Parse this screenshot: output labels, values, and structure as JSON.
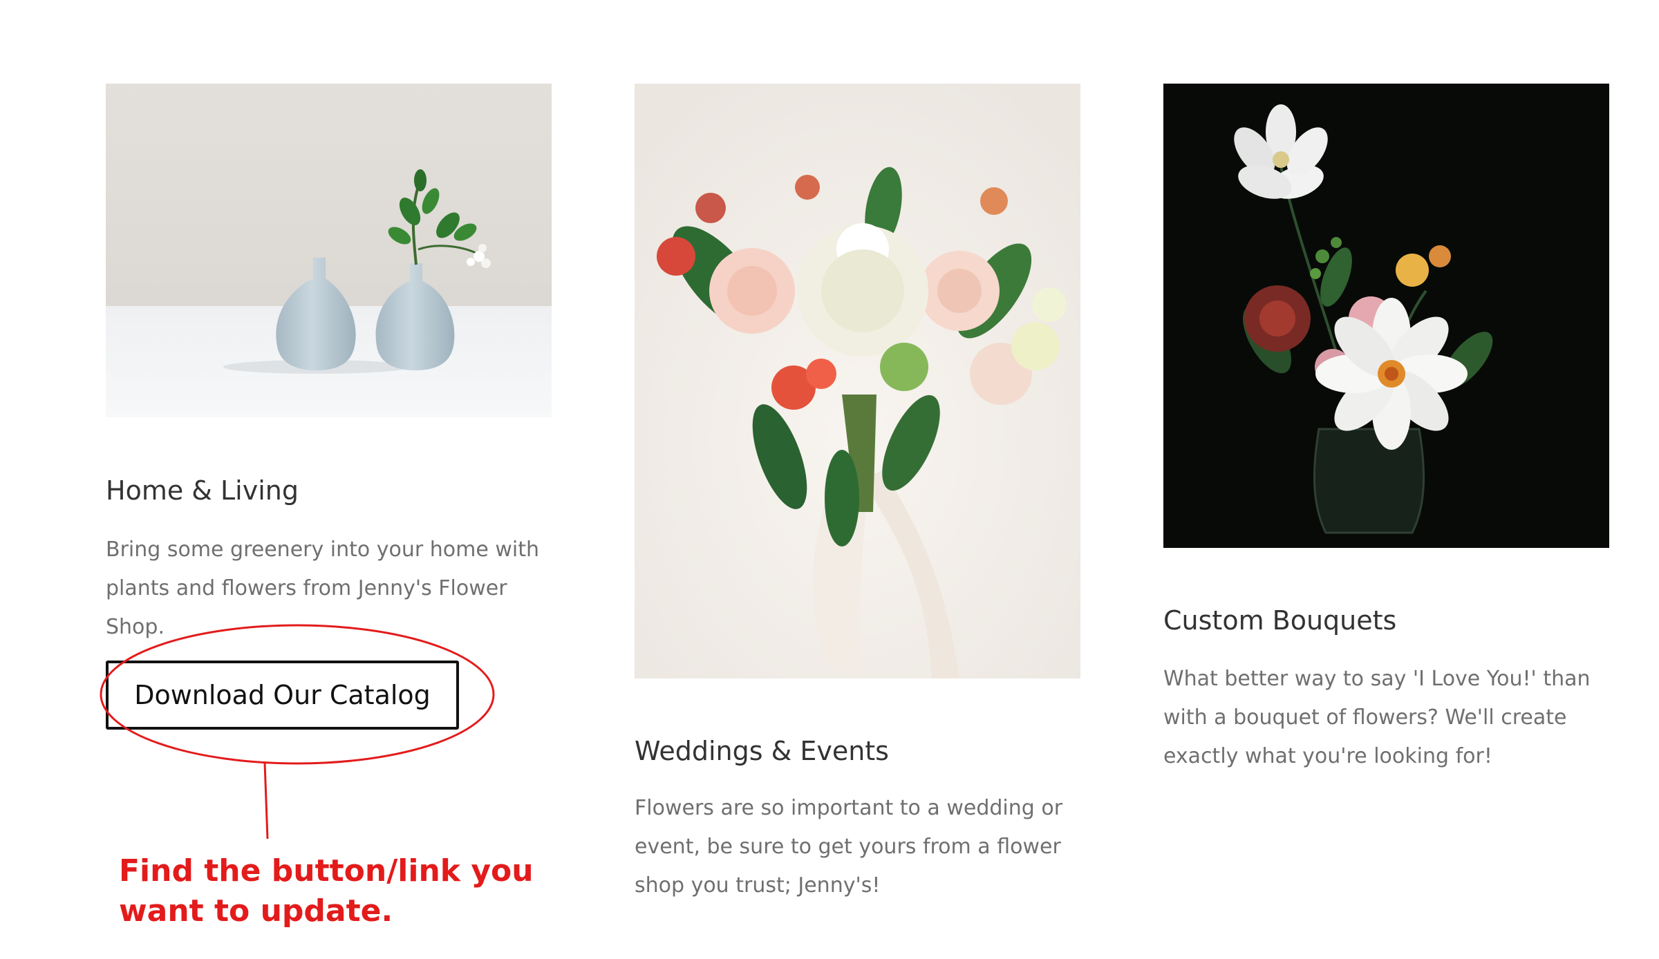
{
  "cards": [
    {
      "title": "Home & Living",
      "description": "Bring some greenery into your home with plants and flowers from Jenny's Flower Shop.",
      "button_label": "Download Our Catalog",
      "image": "two-vases-with-greenery-photo"
    },
    {
      "title": "Weddings & Events",
      "description": "Flowers are so important to a wedding or event, be sure to get yours from a flower shop you trust; Jenny's!",
      "image": "wedding-bouquet-photo"
    },
    {
      "title": "Custom Bouquets",
      "description": "What better way to say 'I Love You!' than with a bouquet of flowers? We'll create exactly what you're looking for!",
      "image": "dark-bouquet-in-jar-photo"
    }
  ],
  "annotation": {
    "text": "Find the button/link you want to update.",
    "color": "#e31b1b"
  }
}
